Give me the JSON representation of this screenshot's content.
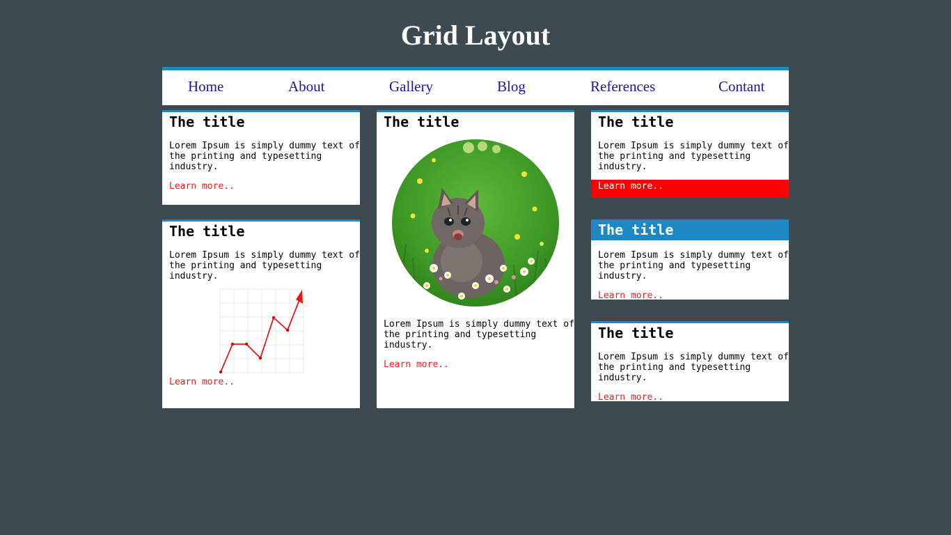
{
  "header": {
    "title": "Grid Layout"
  },
  "nav": {
    "items": [
      {
        "label": "Home"
      },
      {
        "label": "About"
      },
      {
        "label": "Gallery"
      },
      {
        "label": "Blog"
      },
      {
        "label": "References"
      },
      {
        "label": "Contant"
      }
    ]
  },
  "cards": [
    {
      "title": "The title",
      "text_line1": "Lorem Ipsum is simply dummy text of",
      "text_line2": "the printing and typesetting",
      "text_line3": "industry.",
      "link": "Learn more.."
    },
    {
      "title": "The title",
      "text_line1": "Lorem Ipsum is simply dummy text of",
      "text_line2": "the printing and typesetting",
      "text_line3": "industry.",
      "link": "Learn more.."
    },
    {
      "title": "The title",
      "text_line1": "Lorem Ipsum is simply dummy text of",
      "text_line2": "the printing and typesetting",
      "text_line3": "industry.",
      "link": "Learn more.."
    },
    {
      "title": "The title",
      "text_line1": "Lorem Ipsum is simply dummy text of",
      "text_line2": "the printing and typesetting",
      "text_line3": "industry.",
      "link": "Learn more.."
    },
    {
      "title": "The title",
      "text_line1": "Lorem Ipsum is simply dummy text of",
      "text_line2": "the printing and typesetting",
      "text_line3": "industry.",
      "link": "Learn more.."
    },
    {
      "title": "The title",
      "text_line1": "Lorem Ipsum is simply dummy text of",
      "text_line2": "the printing and typesetting",
      "text_line3": "industry.",
      "link": "Learn more.."
    }
  ],
  "images": {
    "kitten": "kitten-in-grass-photo",
    "chart": "trend-up-chart-icon"
  },
  "colors": {
    "background": "#3d4a52",
    "accent": "#1e88c4",
    "link": "#ee1c1c",
    "nav_link": "#2a0fa0",
    "highlight": "#ff0000"
  }
}
